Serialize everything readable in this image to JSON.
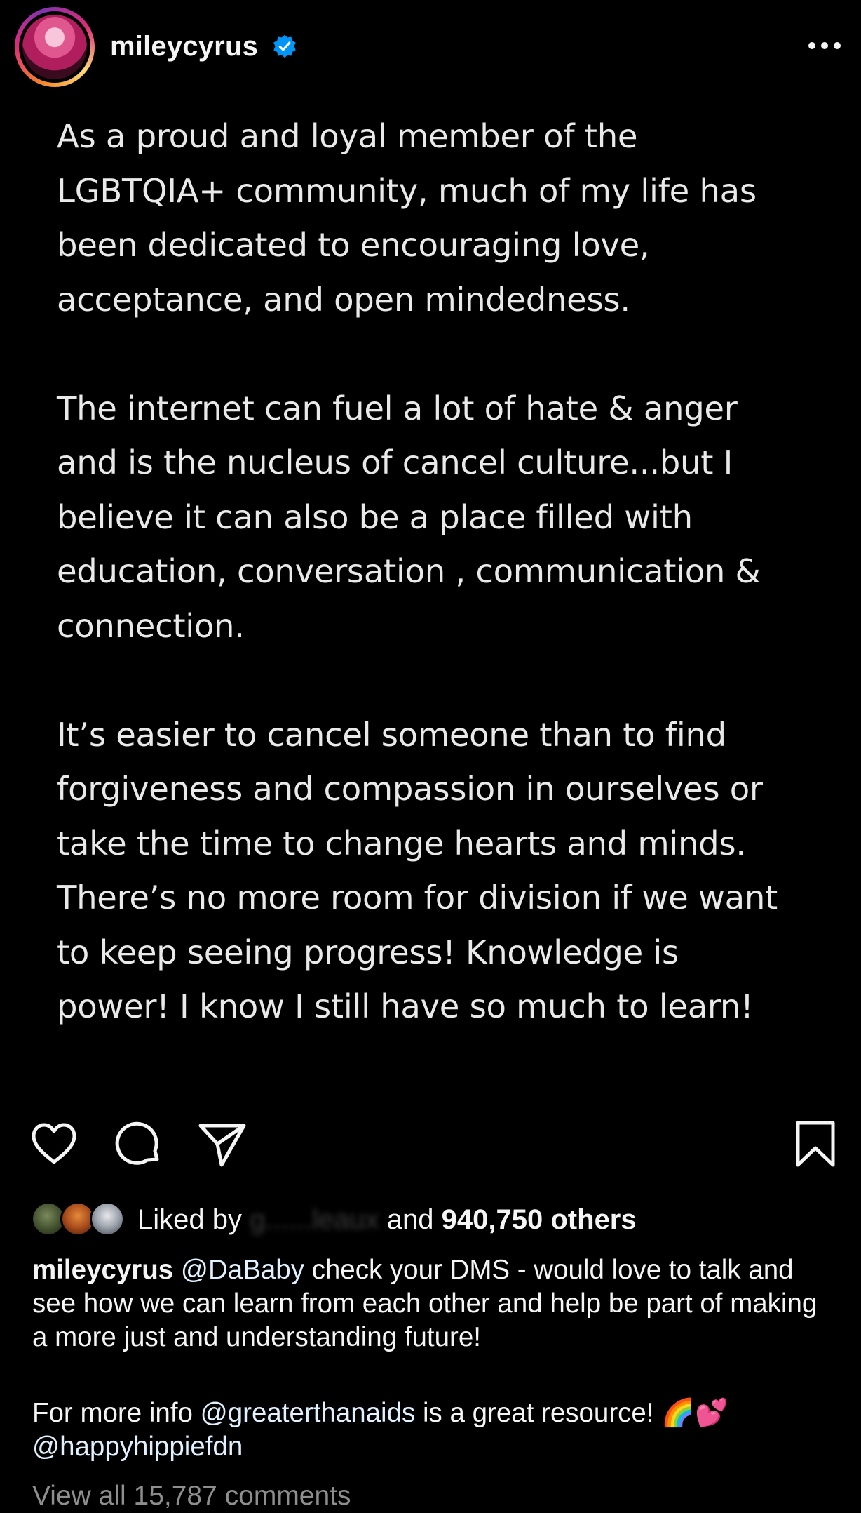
{
  "header": {
    "username": "mileycyrus",
    "verified": true,
    "avatar_icon": "profile-avatar",
    "more_icon": "more-horizontal-icon"
  },
  "post": {
    "statement_paragraphs": [
      "As a proud and loyal member of the\nLGBTQIA+ community, much of my life has\nbeen dedicated to encouraging love,\nacceptance, and open mindedness.",
      "The internet can fuel a lot of hate & anger\nand is the nucleus of cancel culture...but I\nbelieve it can also be a place filled with\neducation, conversation , communication &\nconnection.",
      "It’s easier to cancel someone than to find\nforgiveness and compassion in ourselves or\ntake the time to change hearts and minds.\nThere’s no more room for division if we want\nto keep seeing progress! Knowledge is\npower! I know I still have so much to learn!"
    ]
  },
  "actions": {
    "like_icon": "heart-icon",
    "comment_icon": "comment-bubble-icon",
    "share_icon": "paper-plane-icon",
    "save_icon": "bookmark-icon"
  },
  "likes": {
    "prefix": "Liked by",
    "liker_blurred": "g......leaux",
    "middle": "and",
    "count_text": "940,750 others"
  },
  "caption": {
    "username": "mileycyrus",
    "mention_1": "@DaBaby",
    "text_1": " check your DMS - would love to talk and see how we can learn from each other and help be part of making a more just and understanding future!",
    "text_2_prefix": "For more info ",
    "mention_2": "@greaterthanaids",
    "text_2_suffix": " is a great resource! 🌈💕",
    "mention_3": "@happyhippiefdn"
  },
  "comments": {
    "view_all": "View all 15,787 comments"
  },
  "colors": {
    "background": "#000000",
    "text": "#f5f5f5",
    "statement_text": "#e9e9e9",
    "muted": "#8e8e8e",
    "verified_blue": "#0095f6",
    "mention": "#e0f1ff"
  }
}
